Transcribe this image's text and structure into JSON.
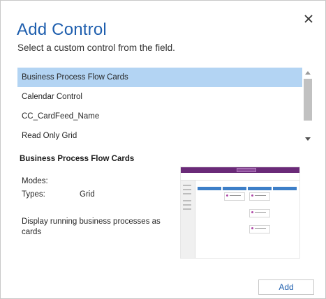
{
  "dialog": {
    "title": "Add Control",
    "subtitle": "Select a custom control from the field.",
    "close_icon": "close-icon",
    "add_label": "Add"
  },
  "controls_list": {
    "items": [
      {
        "label": "Business Process Flow Cards",
        "selected": true
      },
      {
        "label": "Calendar Control",
        "selected": false
      },
      {
        "label": "CC_CardFeed_Name",
        "selected": false
      },
      {
        "label": "Read Only Grid",
        "selected": false
      }
    ]
  },
  "details": {
    "title": "Business Process Flow Cards",
    "modes_label": "Modes:",
    "types_label": "Types:",
    "types_value": "Grid",
    "description": "Display running business processes as cards"
  },
  "colors": {
    "title": "#1f5fae",
    "selection": "#b3d4f3",
    "accent": "#6a2a78"
  }
}
